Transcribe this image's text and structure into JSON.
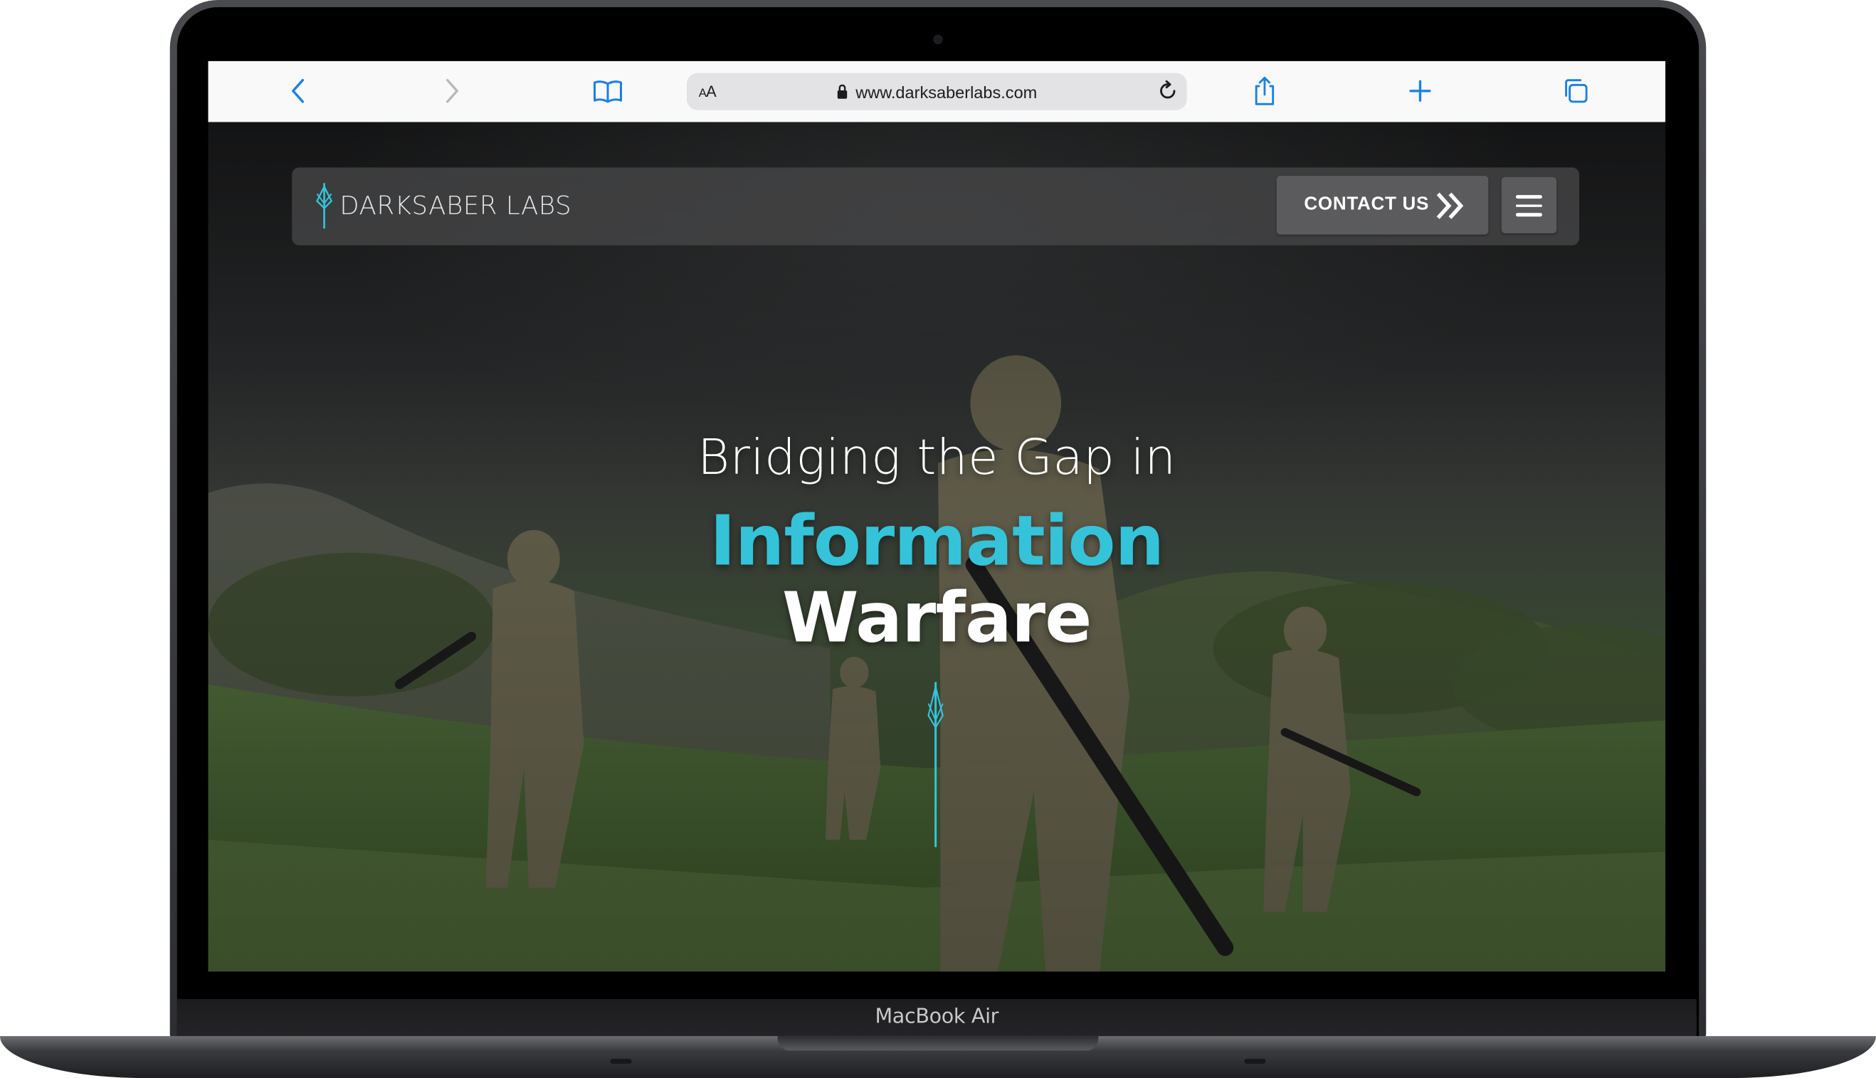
{
  "device": {
    "label": "MacBook Air"
  },
  "browser": {
    "aa_label_small": "A",
    "aa_label_large": "A",
    "url": "www.darksaberlabs.com",
    "icons": [
      "back-icon",
      "forward-icon",
      "bookmarks-icon",
      "lock-icon",
      "reload-icon",
      "share-icon",
      "new-tab-icon",
      "tabs-icon"
    ]
  },
  "site": {
    "brand": "DARKSABER LABS",
    "nav": {
      "contact_label": "CONTACT US",
      "menu_icon": "hamburger-icon"
    },
    "hero": {
      "line1": "Bridging the Gap in",
      "line2": "Information",
      "line3": "Warfare"
    },
    "colors": {
      "accent": "#34c3d9",
      "nav_bg": "#464648",
      "button_bg": "#5b5b5d"
    }
  }
}
